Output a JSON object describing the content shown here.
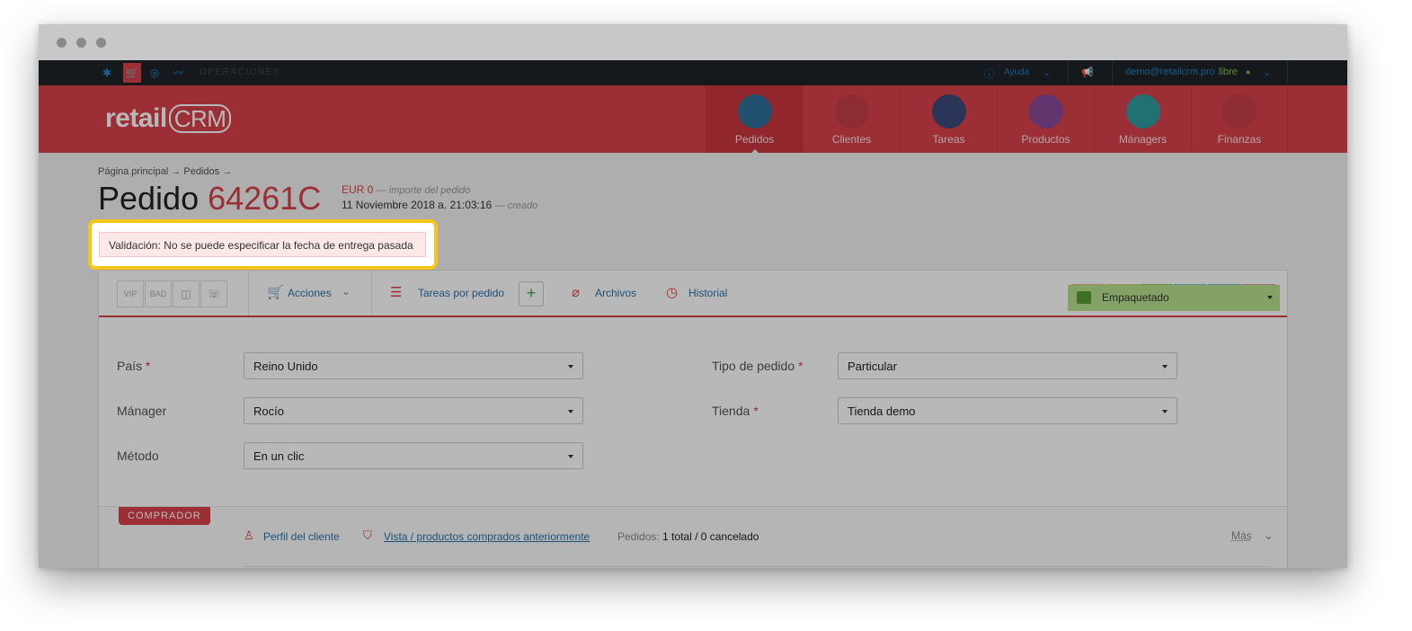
{
  "topbar": {
    "section": "OPERACIONES",
    "help": "Ayuda",
    "email": "demo@retailcrm.pro",
    "plan": "libre"
  },
  "brand": {
    "logo_text": "retail",
    "logo_crm": "CRM"
  },
  "nav": [
    {
      "label": "Pedidos",
      "color": "#2f6f99"
    },
    {
      "label": "Clientes",
      "color": "#c43f47"
    },
    {
      "label": "Tareas",
      "color": "#3b4a7a"
    },
    {
      "label": "Productos",
      "color": "#8a4a9a"
    },
    {
      "label": "Mánagers",
      "color": "#2f9da0"
    },
    {
      "label": "Finanzas",
      "color": "#c43f47"
    }
  ],
  "breadcrumb": "Página principal → Pedidos →",
  "order": {
    "title_prefix": "Pedido",
    "number": "64261C",
    "amount": "EUR 0",
    "amount_note": "— importe del pedido",
    "date": "11 Noviembre 2018 a. 21:03:16",
    "date_note": "— creado"
  },
  "alert": {
    "text": "Validación: No se puede especificar la fecha de entrega pasada"
  },
  "toolbar": {
    "tags": [
      "VIP",
      "BAD"
    ],
    "actions": "Acciones",
    "tasks": "Tareas por pedido",
    "files": "Archivos",
    "history": "Historial",
    "status": "Empaquetado"
  },
  "form": {
    "pais_label": "País",
    "pais_value": "Reino Unido",
    "manager_label": "Mánager",
    "manager_value": "Rocío",
    "metodo_label": "Método",
    "metodo_value": "En un clic",
    "tipo_label": "Tipo de pedido",
    "tipo_value": "Particular",
    "tienda_label": "Tienda",
    "tienda_value": "Tienda demo"
  },
  "buyer": {
    "tag": "COMPRADOR",
    "profile": "Perfil del cliente",
    "history": "Vista / productos comprados anteriormente",
    "orders_label": "Pedidos:",
    "orders_value": "1 total / 0 cancelado",
    "more": "Más"
  },
  "colors": {
    "brand_red": "#d9414a",
    "alert_highlight": "#f5c518",
    "status_green": "#b8e08e"
  }
}
